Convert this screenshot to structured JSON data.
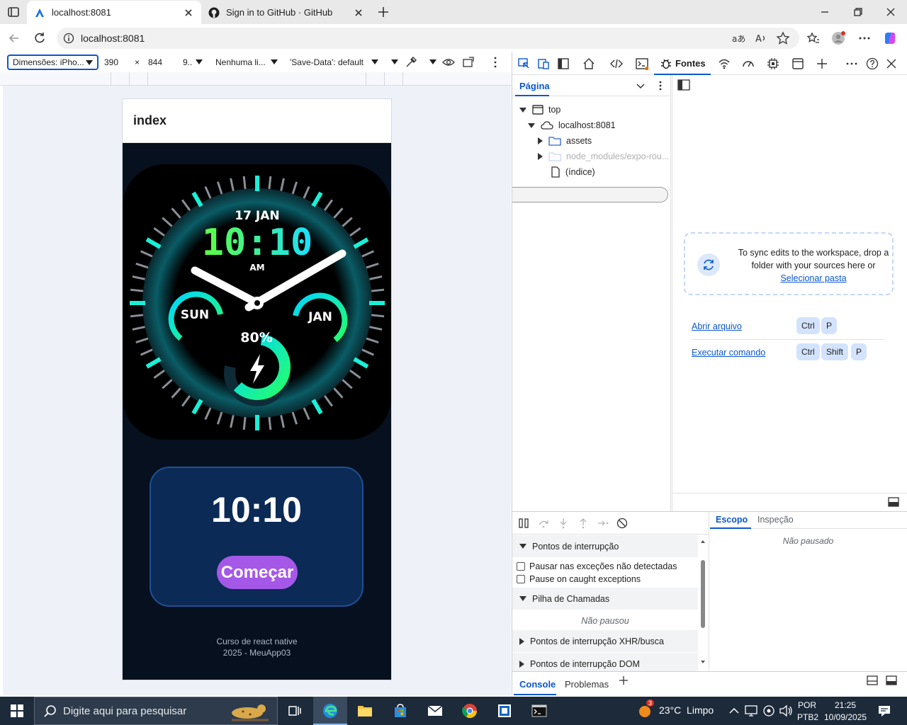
{
  "browser": {
    "tabs": [
      {
        "title": "localhost:8081",
        "active": true
      },
      {
        "title": "Sign in to GitHub · GitHub",
        "active": false
      }
    ],
    "url": "localhost:8081"
  },
  "device_toolbar": {
    "dimensions": "Dimensões: iPho...",
    "width": "390",
    "times": "×",
    "height": "844",
    "zoom": "9..",
    "throttle": "Nenhuma li...",
    "save_data": "'Save-Data': default"
  },
  "app": {
    "header_title": "index",
    "watch": {
      "date": "17 JAN",
      "time": "10:10",
      "ampm": "AM",
      "left_dial": "SUN",
      "right_dial": "JAN",
      "battery": "80%",
      "battery_level": 0.8,
      "accent_color": "#19f0d8"
    },
    "card_time": "10:10",
    "start_button": "Começar",
    "footer_line1": "Curso de react native",
    "footer_line2": "2025 - MeuApp03"
  },
  "devtools": {
    "active_tab": "Fontes",
    "page_tab": "Página",
    "tree": {
      "top": "top",
      "host": "localhost:8081",
      "assets": "assets",
      "node_modules": "node_modules/expo-rou...",
      "index": "(índice)"
    },
    "sync_text": "To sync edits to the workspace, drop a folder with your sources here or",
    "select_folder": "Selecionar pasta",
    "open_file": "Abrir arquivo",
    "open_file_keys": [
      "Ctrl",
      "P"
    ],
    "run_command": "Executar comando",
    "run_command_keys": [
      "Ctrl",
      "Shift",
      "P"
    ],
    "breakpoints_title": "Pontos de interrupção",
    "pause_uncaught": "Pausar nas exceções não detectadas",
    "pause_caught": "Pause on caught exceptions",
    "call_stack_title": "Pilha de Chamadas",
    "not_paused_stack": "Não pausou",
    "xhr_breakpoints": "Pontos de interrupção XHR/busca",
    "dom_breakpoints": "Pontos de interrupção DOM",
    "scope_tab": "Escopo",
    "inspect_tab": "Inspeção",
    "not_paused": "Não pausado",
    "console_tab": "Console",
    "problems_tab": "Problemas"
  },
  "taskbar": {
    "search_placeholder": "Digite aqui para pesquisar",
    "weather_badge": "3",
    "weather": "23°C  Limpo",
    "lang_line1": "POR",
    "lang_line2": "PTB2",
    "time": "21:25",
    "date": "10/09/2025"
  }
}
